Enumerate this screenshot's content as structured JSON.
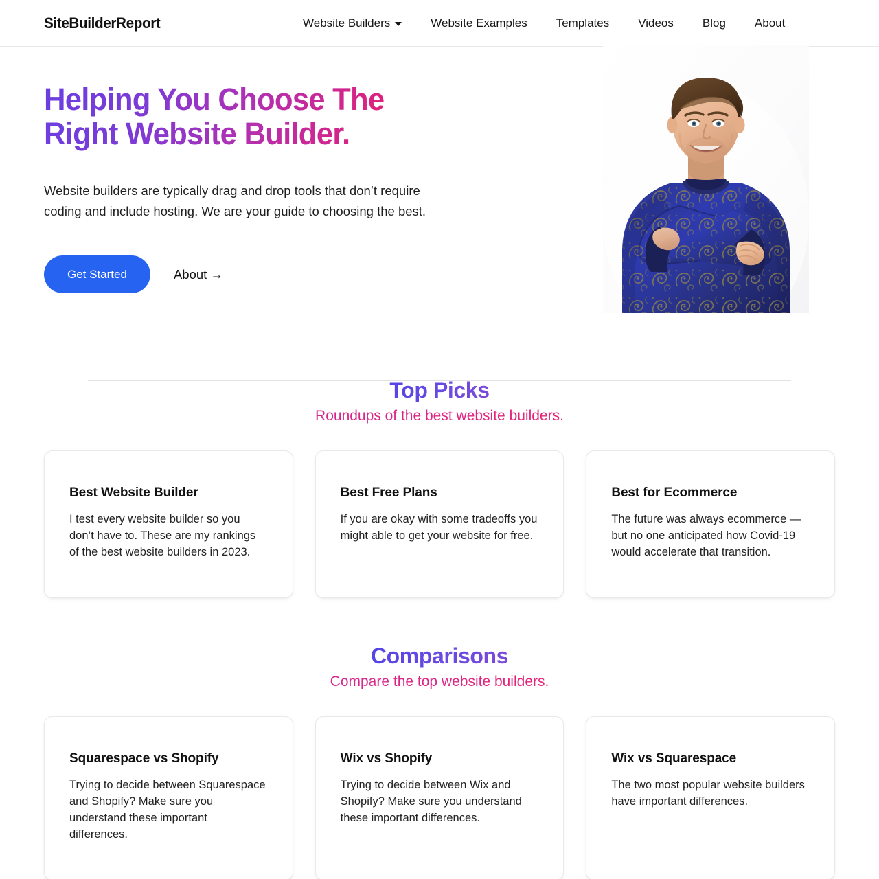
{
  "header": {
    "logo": "SiteBuilderReport",
    "nav": [
      {
        "label": "Website Builders",
        "has_caret": true,
        "icon": "chevron-down-icon"
      },
      {
        "label": "Website Examples",
        "has_caret": false
      },
      {
        "label": "Templates",
        "has_caret": false
      },
      {
        "label": "Videos",
        "has_caret": false
      },
      {
        "label": "Blog",
        "has_caret": false
      },
      {
        "label": "About",
        "has_caret": false
      }
    ]
  },
  "hero": {
    "title": "Helping You Choose The\nRight Website Builder.",
    "subtitle": "Website builders are typically drag and drop tools that don’t require coding and include hosting. We are your guide to choosing the best.",
    "primary_cta": "Get Started",
    "secondary_cta": "About →",
    "photo_alt": "portrait-photo-man-arms-crossed-blue-paisley-sweater"
  },
  "sections": [
    {
      "id": "picks",
      "title": "Top Picks",
      "subtitle": "Roundups of the best website builders.",
      "cards": [
        {
          "title": "Best Website Builder",
          "text": "I test every website builder so you don’t have to. These are my rankings of the best website builders in 2023."
        },
        {
          "title": "Best Free Plans",
          "text": "If you are okay with some tradeoffs you might able to get your website for free."
        },
        {
          "title": "Best for Ecommerce",
          "text": "The future was always ecommerce — but no one anticipated how Covid-19 would accelerate that transition."
        }
      ]
    },
    {
      "id": "comparisons",
      "title": "Comparisons",
      "subtitle": "Compare the top website builders.",
      "cards": [
        {
          "title": "Squarespace vs Shopify",
          "text": "Trying to decide between Squarespace and Shopify? Make sure you understand these important differences."
        },
        {
          "title": "Wix vs Shopify",
          "text": "Trying to decide between Wix and Shopify? Make sure you understand these important differences."
        },
        {
          "title": "Wix vs Squarespace",
          "text": "The two most popular website builders have important differences."
        }
      ]
    }
  ],
  "colors": {
    "heading_purple": "#6b3fe0",
    "heading_pink": "#e31f76",
    "section_title_purple": "#5544e6",
    "section_subtitle_pink": "#dd2484",
    "primary_button": "#2563f0",
    "text": "#1a1a1a",
    "card_border": "#e9e9e9"
  }
}
